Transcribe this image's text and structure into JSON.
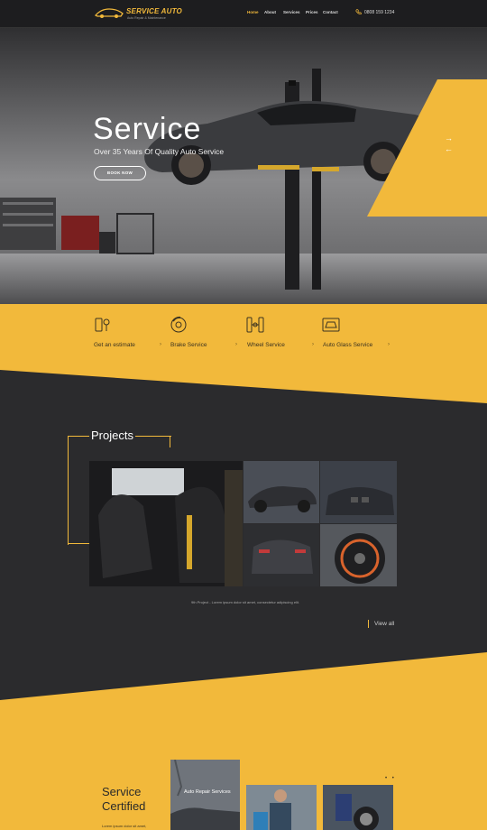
{
  "header": {
    "logo_title": "SERVICE AUTO",
    "logo_subtitle": "Auto Repair & Maintenance",
    "nav": [
      "Home",
      "About",
      "Services",
      "Prices",
      "Contact"
    ],
    "active_nav": "Home",
    "phone": "0808 159 1234"
  },
  "hero": {
    "title": "Service",
    "subtitle": "Over 35 Years Of Quality Auto Service",
    "button": "BOOK NOW",
    "next_arrow": "→",
    "prev_arrow": "←"
  },
  "services": [
    {
      "label": "Get an estimate",
      "icon": "estimate-icon"
    },
    {
      "label": "Brake Service",
      "icon": "brake-disc-icon"
    },
    {
      "label": "Wheel Service",
      "icon": "wheel-icon"
    },
    {
      "label": "Auto Glass Service",
      "icon": "auto-glass-icon"
    }
  ],
  "services_chevron": "›",
  "projects": {
    "title": "Projects",
    "caption": "9th Project  -  Lorem ipsum dolor sit amet, consectetur adipiscing elit.",
    "view_all": "View all"
  },
  "certified": {
    "title_line1": "Service",
    "title_line2": "Certified",
    "text": "Lorem ipsum dolor sit amet,",
    "photo_label": "Auto Repair Services",
    "dots": "• •"
  },
  "colors": {
    "accent": "#f2b93b",
    "dark": "#2b2b2d",
    "header": "#1d1d1f"
  }
}
